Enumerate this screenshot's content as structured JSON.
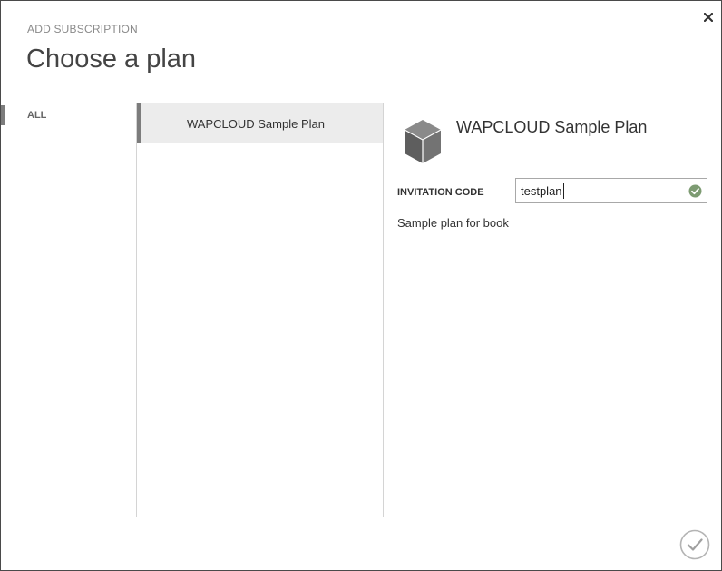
{
  "header": {
    "eyebrow": "ADD SUBSCRIPTION",
    "title": "Choose a plan"
  },
  "filters": {
    "items": [
      {
        "label": "ALL"
      }
    ]
  },
  "plans": {
    "items": [
      {
        "label": "WAPCLOUD Sample Plan"
      }
    ]
  },
  "detail": {
    "plan_name": "WAPCLOUD Sample Plan",
    "invitation_code_label": "INVITATION CODE",
    "invitation_code_value": "testplan",
    "description": "Sample plan for book"
  },
  "icons": {
    "close": "close-icon",
    "plan": "cube-icon",
    "validation": "checkmark-circle-icon",
    "submit": "checkmark-icon"
  },
  "colors": {
    "accent_bar": "#7c7c7c",
    "selected_bg": "#ececec",
    "valid_green": "#7d9b72"
  }
}
